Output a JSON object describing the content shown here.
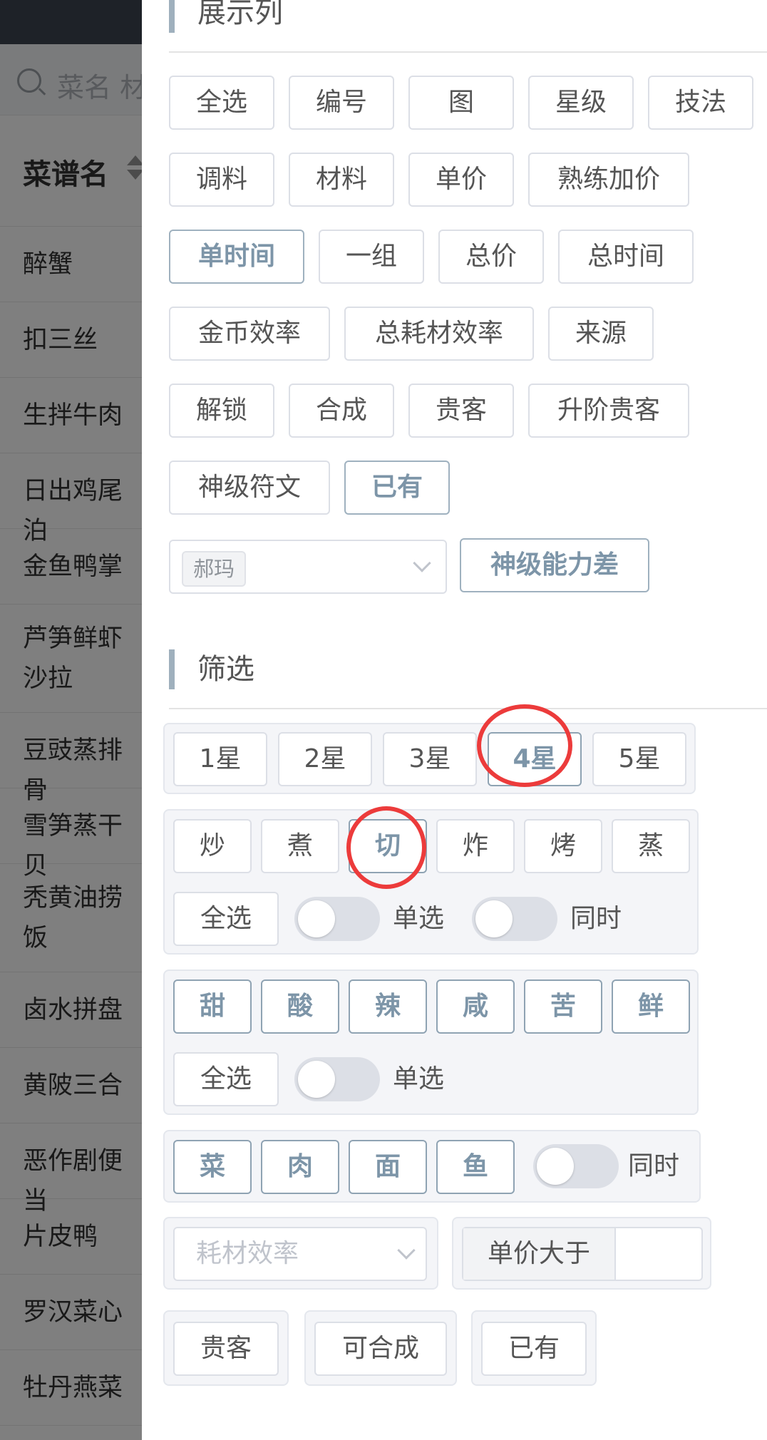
{
  "background_list": {
    "search_placeholder": "菜名 材",
    "column_title": "菜谱名",
    "rows": [
      "醉蟹",
      "扣三丝",
      "生拌牛肉",
      "日出鸡尾泊",
      "金鱼鸭掌",
      "芦笋鲜虾沙拉",
      "豆豉蒸排骨",
      "雪笋蒸干贝",
      "秃黄油捞饭",
      "卤水拼盘",
      "黄陂三合",
      "恶作剧便当",
      "片皮鸭",
      "罗汉菜心",
      "牡丹燕菜"
    ]
  },
  "display_columns": {
    "title": "展示列",
    "tags": [
      {
        "label": "全选",
        "active": false
      },
      {
        "label": "编号",
        "active": false
      },
      {
        "label": "图",
        "active": false
      },
      {
        "label": "星级",
        "active": false
      },
      {
        "label": "技法",
        "active": false
      },
      {
        "label": "调料",
        "active": false
      },
      {
        "label": "材料",
        "active": false
      },
      {
        "label": "单价",
        "active": false
      },
      {
        "label": "熟练加价",
        "active": false
      },
      {
        "label": "单时间",
        "active": true
      },
      {
        "label": "一组",
        "active": false
      },
      {
        "label": "总价",
        "active": false
      },
      {
        "label": "总时间",
        "active": false
      },
      {
        "label": "金币效率",
        "active": false
      },
      {
        "label": "总耗材效率",
        "active": false
      },
      {
        "label": "来源",
        "active": false
      },
      {
        "label": "解锁",
        "active": false
      },
      {
        "label": "合成",
        "active": false
      },
      {
        "label": "贵客",
        "active": false
      },
      {
        "label": "升阶贵客",
        "active": false
      },
      {
        "label": "神级符文",
        "active": false
      },
      {
        "label": "已有",
        "active": true
      }
    ],
    "chef_select_value": "郝玛",
    "god_ability_button": "神级能力差"
  },
  "filter": {
    "title": "筛选",
    "stars": [
      {
        "label": "1星",
        "active": false
      },
      {
        "label": "2星",
        "active": false
      },
      {
        "label": "3星",
        "active": false
      },
      {
        "label": "4星",
        "active": true
      },
      {
        "label": "5星",
        "active": false
      }
    ],
    "skills": [
      {
        "label": "炒",
        "active": false
      },
      {
        "label": "煮",
        "active": false
      },
      {
        "label": "切",
        "active": true
      },
      {
        "label": "炸",
        "active": false
      },
      {
        "label": "烤",
        "active": false
      },
      {
        "label": "蒸",
        "active": false
      }
    ],
    "skills_select_all": "全选",
    "skills_single_label": "单选",
    "skills_single_on": false,
    "skills_simultaneous_label": "同时",
    "skills_simultaneous_on": false,
    "flavors": [
      {
        "label": "甜",
        "active": true
      },
      {
        "label": "酸",
        "active": true
      },
      {
        "label": "辣",
        "active": true
      },
      {
        "label": "咸",
        "active": true
      },
      {
        "label": "苦",
        "active": true
      },
      {
        "label": "鲜",
        "active": true
      }
    ],
    "flavors_select_all": "全选",
    "flavors_single_label": "单选",
    "flavors_single_on": false,
    "materials": [
      {
        "label": "菜",
        "active": true
      },
      {
        "label": "肉",
        "active": true
      },
      {
        "label": "面",
        "active": true
      },
      {
        "label": "鱼",
        "active": true
      }
    ],
    "materials_simultaneous_label": "同时",
    "materials_simultaneous_on": false,
    "efficiency_select_placeholder": "耗材效率",
    "unit_price_label": "单价大于",
    "unit_price_value": "",
    "bottom_buttons": [
      {
        "label": "贵客"
      },
      {
        "label": "可合成"
      },
      {
        "label": "已有"
      }
    ]
  },
  "colors": {
    "accent": "#7d95a8",
    "highlight_circle": "#ec3b3b",
    "overlay": "rgba(0,0,0,0.5)"
  }
}
